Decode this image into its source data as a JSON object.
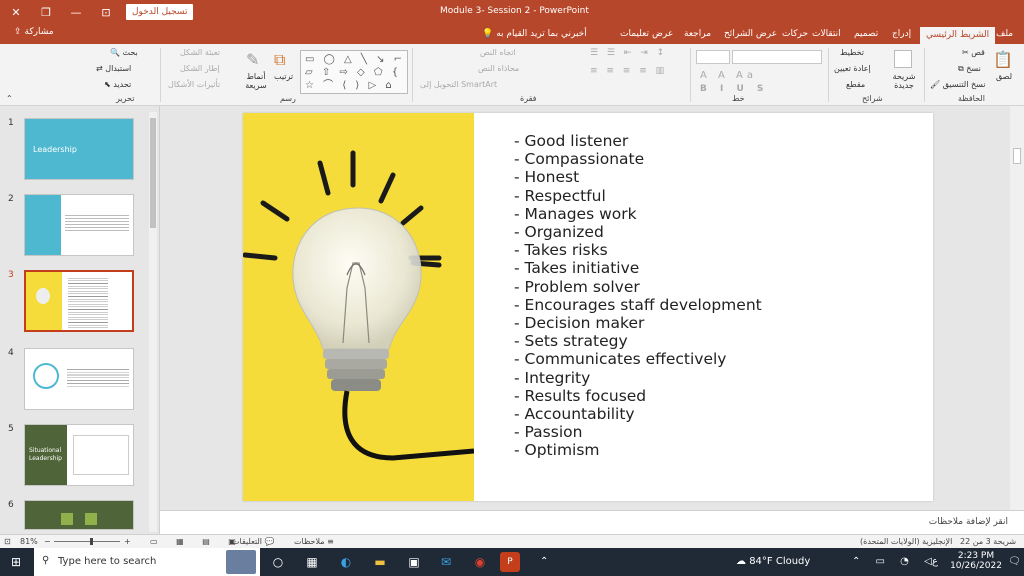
{
  "titlebar": {
    "sign_in": "تسجيل الدخول",
    "document_title": "Module 3- Session 2  -  PowerPoint",
    "close": "✕",
    "restore": "❐",
    "minimize": "—",
    "ribbon_display": "⊡"
  },
  "tabs": {
    "share": "مشاركة",
    "tell_me": "أخبرني بما تريد القيام به",
    "items": [
      "ملف",
      "الشريط الرئيسي",
      "إدراج",
      "تصميم",
      "انتقالات",
      "حركات",
      "عرض الشرائح",
      "مراجعة",
      "عرض",
      "تعليمات"
    ]
  },
  "ribbon": {
    "groups": {
      "clipboard": "الحافظة",
      "slides": "شرائح",
      "font": "خط",
      "paragraph": "فقرة",
      "drawing": "رسم",
      "editing": "تحرير"
    },
    "clipboard": {
      "paste": "لصق",
      "cut": "قص",
      "copy": "نسخ",
      "format_painter": "نسخ التنسيق"
    },
    "slides": {
      "new_slide": "شريحة جديدة",
      "layout": "تخطيط",
      "reset": "إعادة تعيين",
      "section": "مقطع"
    },
    "paragraph": {
      "text_direction": "اتجاه النص",
      "align_text": "محاذاة النص",
      "smartart": "التحويل إلى SmartArt"
    },
    "drawing": {
      "arrange": "ترتيب",
      "quick_styles": "أنماط سريعة",
      "shape_fill": "تعبئة الشكل",
      "shape_outline": "إطار الشكل",
      "shape_effects": "تأثيرات الأشكال"
    },
    "editing": {
      "find": "بحث",
      "replace": "استبدال",
      "select": "تحديد"
    }
  },
  "thumbnails": [
    {
      "num": "1",
      "text": "Leadership"
    },
    {
      "num": "2",
      "text": ""
    },
    {
      "num": "3",
      "text": ""
    },
    {
      "num": "4",
      "text": ""
    },
    {
      "num": "5",
      "text": "Situational Leadership"
    },
    {
      "num": "6",
      "text": ""
    }
  ],
  "slide": {
    "items": [
      "- Good listener",
      "- Compassionate",
      "- Honest",
      "- Respectful",
      "- Manages work",
      "- Organized",
      "- Takes risks",
      "- Takes initiative",
      "- Problem solver",
      "- Encourages staff development",
      "- Decision maker",
      "- Sets strategy",
      "- Communicates effectively",
      "- Integrity",
      "- Results focused",
      "- Accountability",
      "- Passion",
      "- Optimism"
    ]
  },
  "notes": {
    "placeholder": "انقر لإضافة ملاحظات"
  },
  "status": {
    "zoom": "81%",
    "notes_btn": "ملاحظات",
    "comments_btn": "التعليقات",
    "language": "الإنجليزية (الولايات المتحدة)",
    "slide_counter": "شريحة 3 من 22"
  },
  "taskbar": {
    "search_placeholder": "Type here to search",
    "weather": "84°F  Cloudy",
    "time": "2:23 PM",
    "date": "10/26/2022",
    "lang": "ع"
  }
}
